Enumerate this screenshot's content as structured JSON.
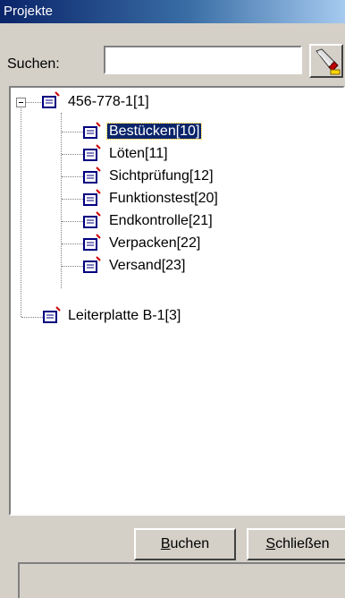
{
  "window": {
    "title": "Projekte"
  },
  "search": {
    "label": "Suchen:",
    "value": "",
    "button_icon": "flashlight-icon"
  },
  "tree": {
    "root": {
      "label": "456-778-1[1]",
      "icon": "document-icon",
      "expanded": true
    },
    "children": [
      {
        "label": "Bestücken[10]",
        "selected": true
      },
      {
        "label": "Löten[11]"
      },
      {
        "label": "Sichtprüfung[12]"
      },
      {
        "label": "Funktionstest[20]"
      },
      {
        "label": "Endkontrolle[21]"
      },
      {
        "label": "Verpacken[22]"
      },
      {
        "label": "Versand[23]"
      }
    ],
    "second_root": {
      "label": "Leiterplatte B-1[3]",
      "icon": "document-icon"
    }
  },
  "buttons": {
    "book": {
      "mnemonic": "B",
      "rest": "uchen"
    },
    "close": {
      "mnemonic": "S",
      "rest": "chließen"
    }
  },
  "colors": {
    "selection": "#0a246a",
    "titlebar": "#0a246a",
    "face": "#d4d0c8"
  }
}
